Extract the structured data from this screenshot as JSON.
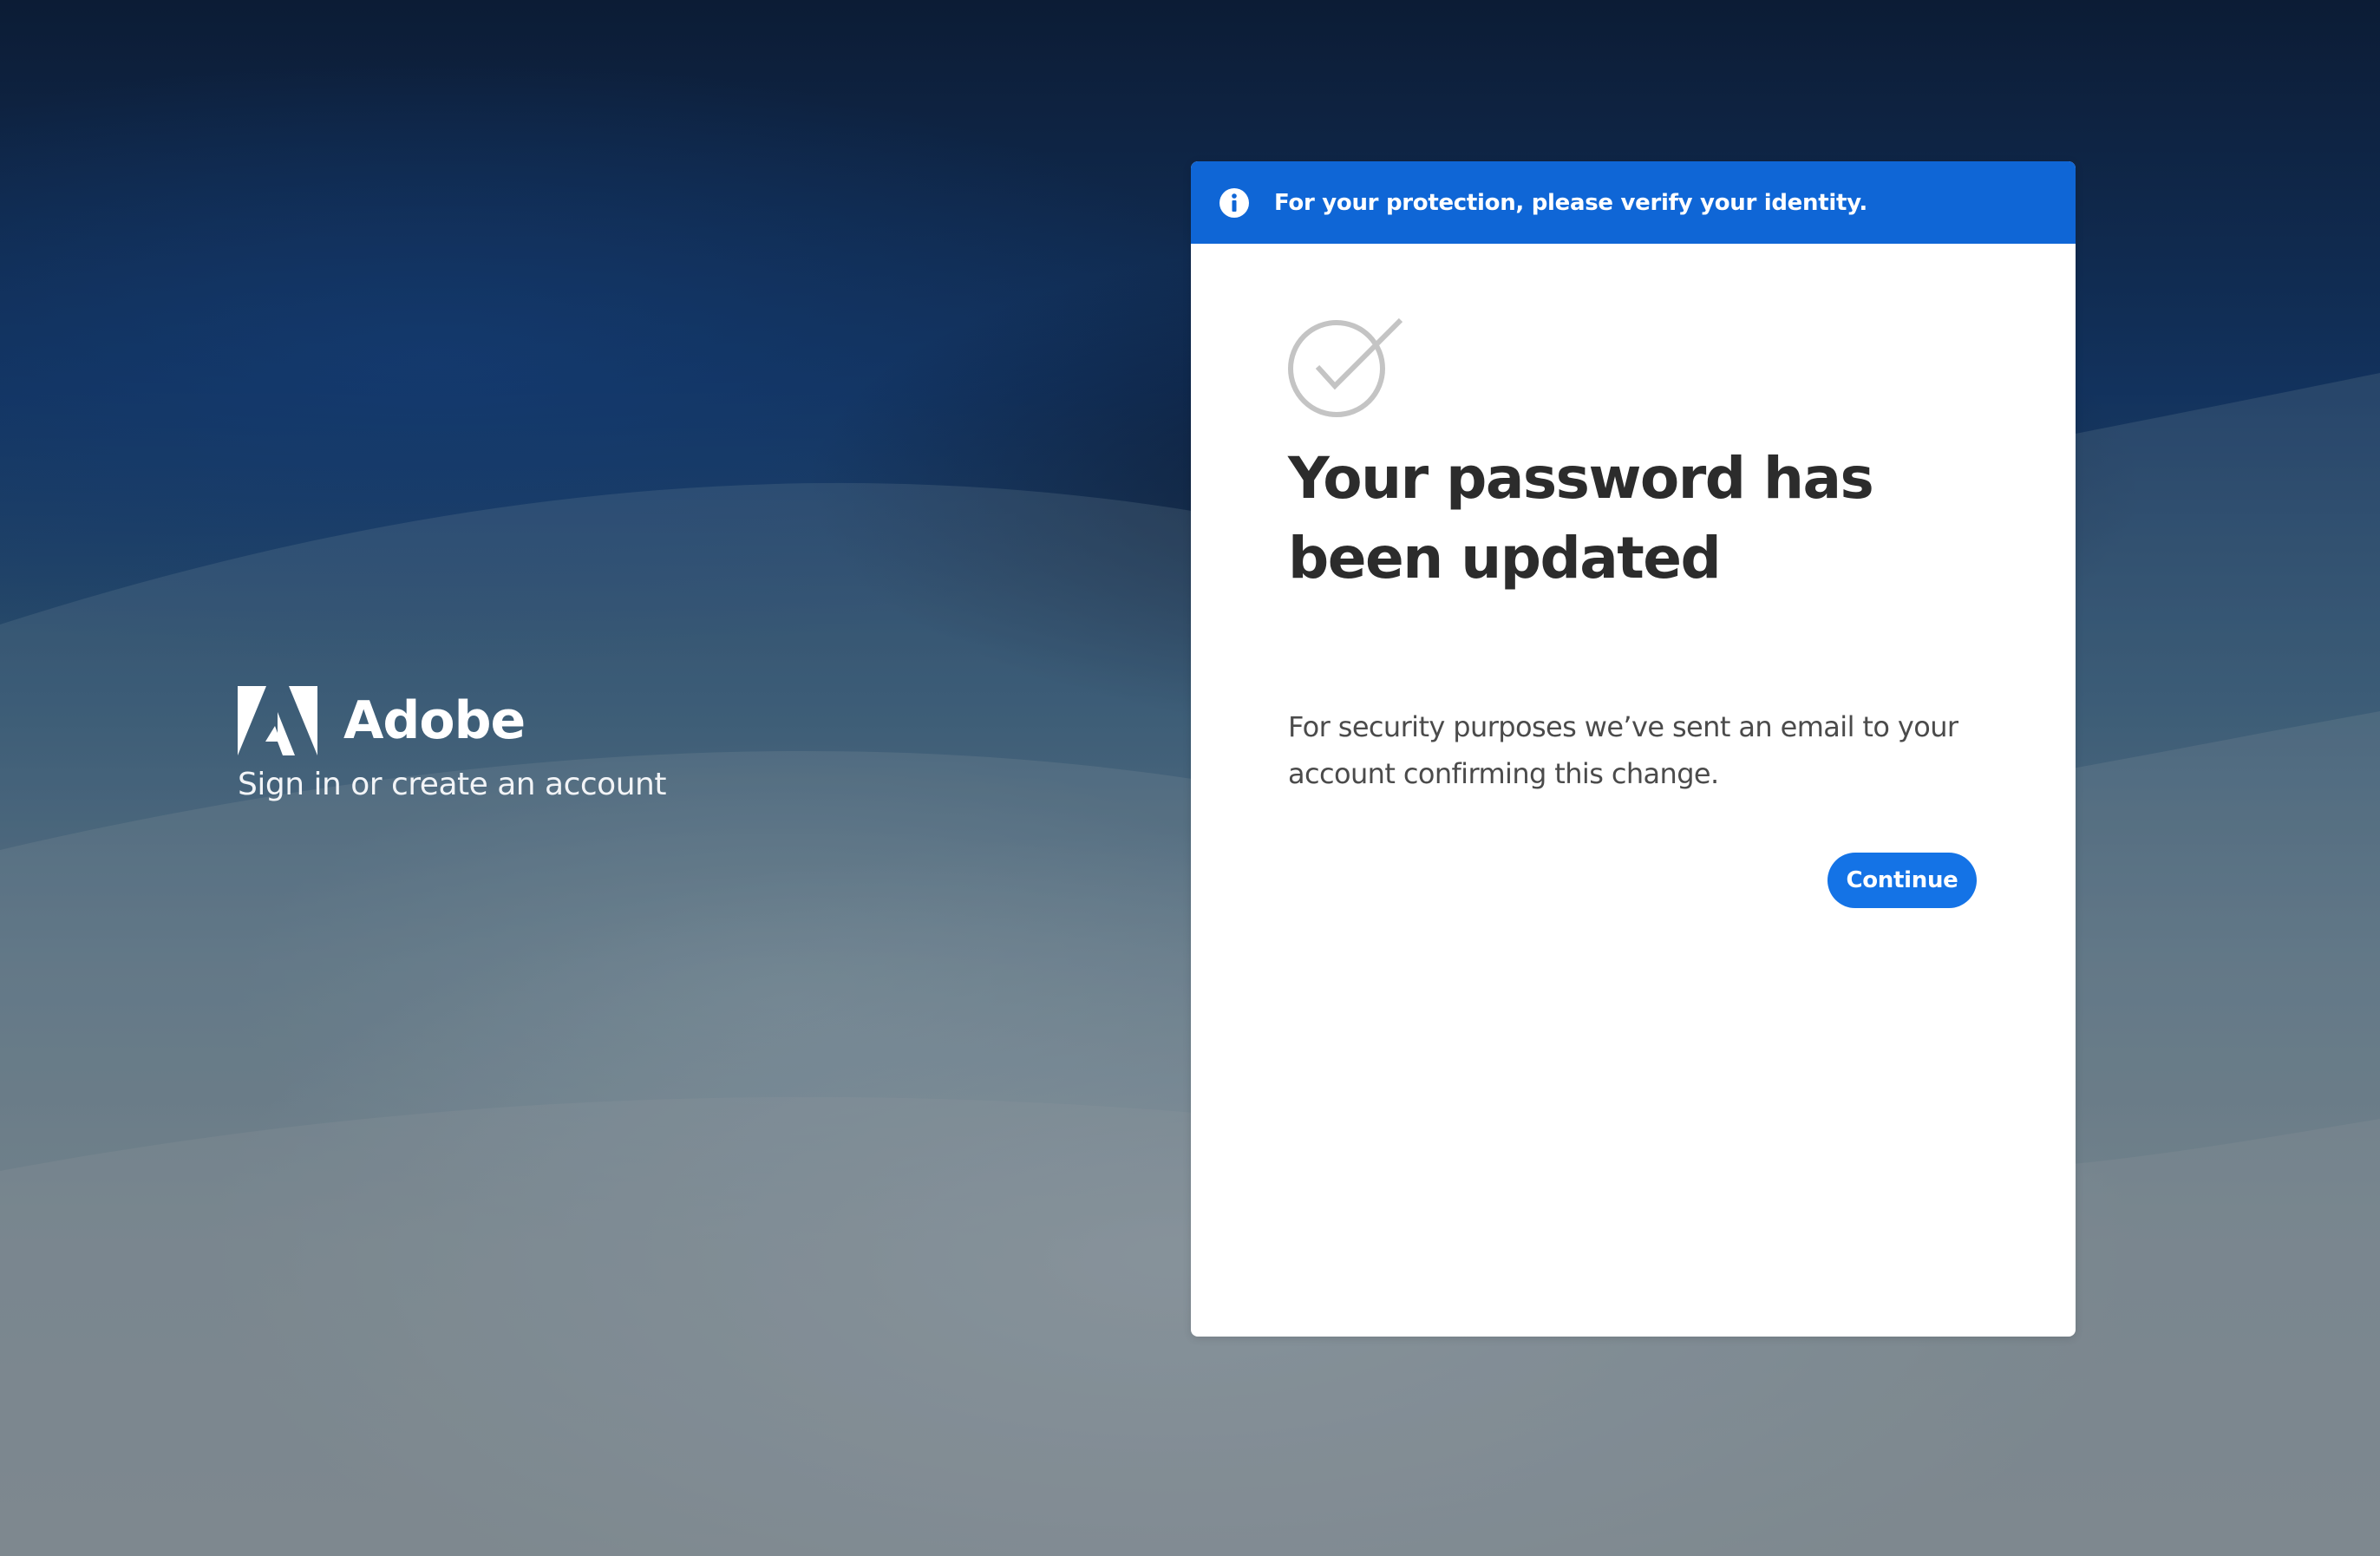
{
  "brand": {
    "name": "Adobe",
    "tagline": "Sign in or create an account",
    "logo_icon": "adobe-logo-icon"
  },
  "banner": {
    "icon": "info-icon",
    "text": "For your protection, please verify your identity.",
    "color": "#0f66d6"
  },
  "card": {
    "status_icon": "check-circle-icon",
    "title": "Your password has been updated",
    "description": "For security purposes we’ve sent an email to your account confirming this change.",
    "continue_label": "Continue",
    "accent_color": "#1473e6"
  }
}
